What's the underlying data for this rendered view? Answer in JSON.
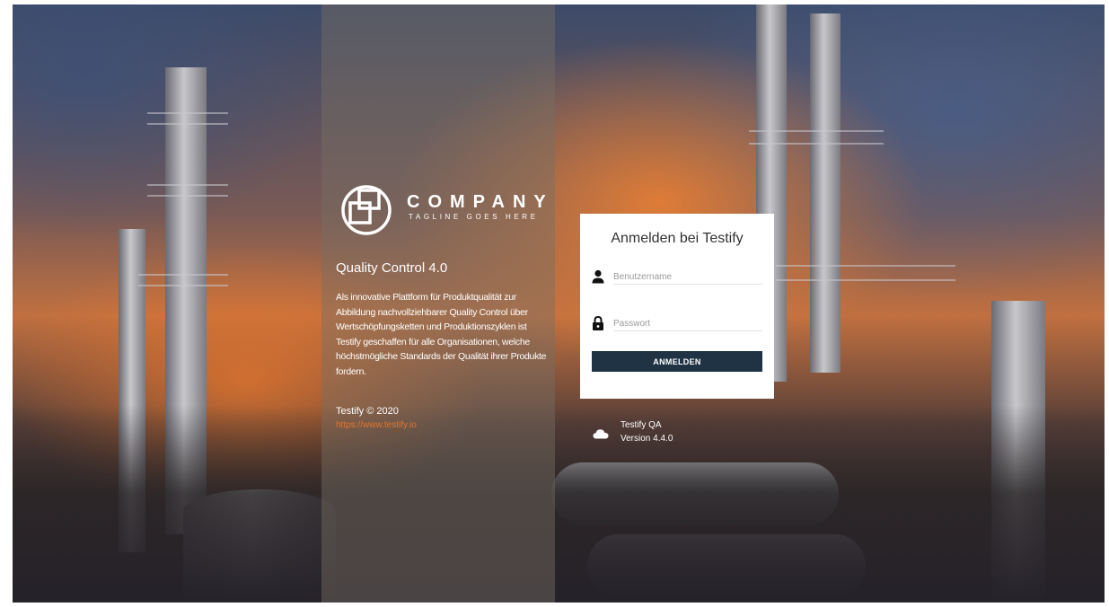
{
  "logo": {
    "name": "COMPANY",
    "tagline": "TAGLINE GOES HERE"
  },
  "info": {
    "title": "Quality Control 4.0",
    "description": "Als innovative Plattform für Produktqualität zur Abbildung nachvollziehbarer Quality Control über Wertschöpfungsketten und Produktionszyklen ist Testify geschaffen für alle Organisationen, welche höchstmögliche Standards der Qualität ihrer Produkte fordern.",
    "copyright": "Testify © 2020",
    "link": "https://www.testify.io"
  },
  "login": {
    "title": "Anmelden bei Testify",
    "username_placeholder": "Benutzername",
    "password_placeholder": "Passwort",
    "submit_label": "ANMELDEN"
  },
  "version": {
    "name": "Testify QA",
    "number": "Version 4.4.0"
  },
  "icons": {
    "user": "user-icon",
    "lock": "lock-icon",
    "cloud": "cloud-icon",
    "logo": "company-logo-icon"
  },
  "colors": {
    "button_bg": "#1f3344",
    "link": "#e3772c",
    "panel_overlay": "rgba(120,110,100,0.45)"
  }
}
